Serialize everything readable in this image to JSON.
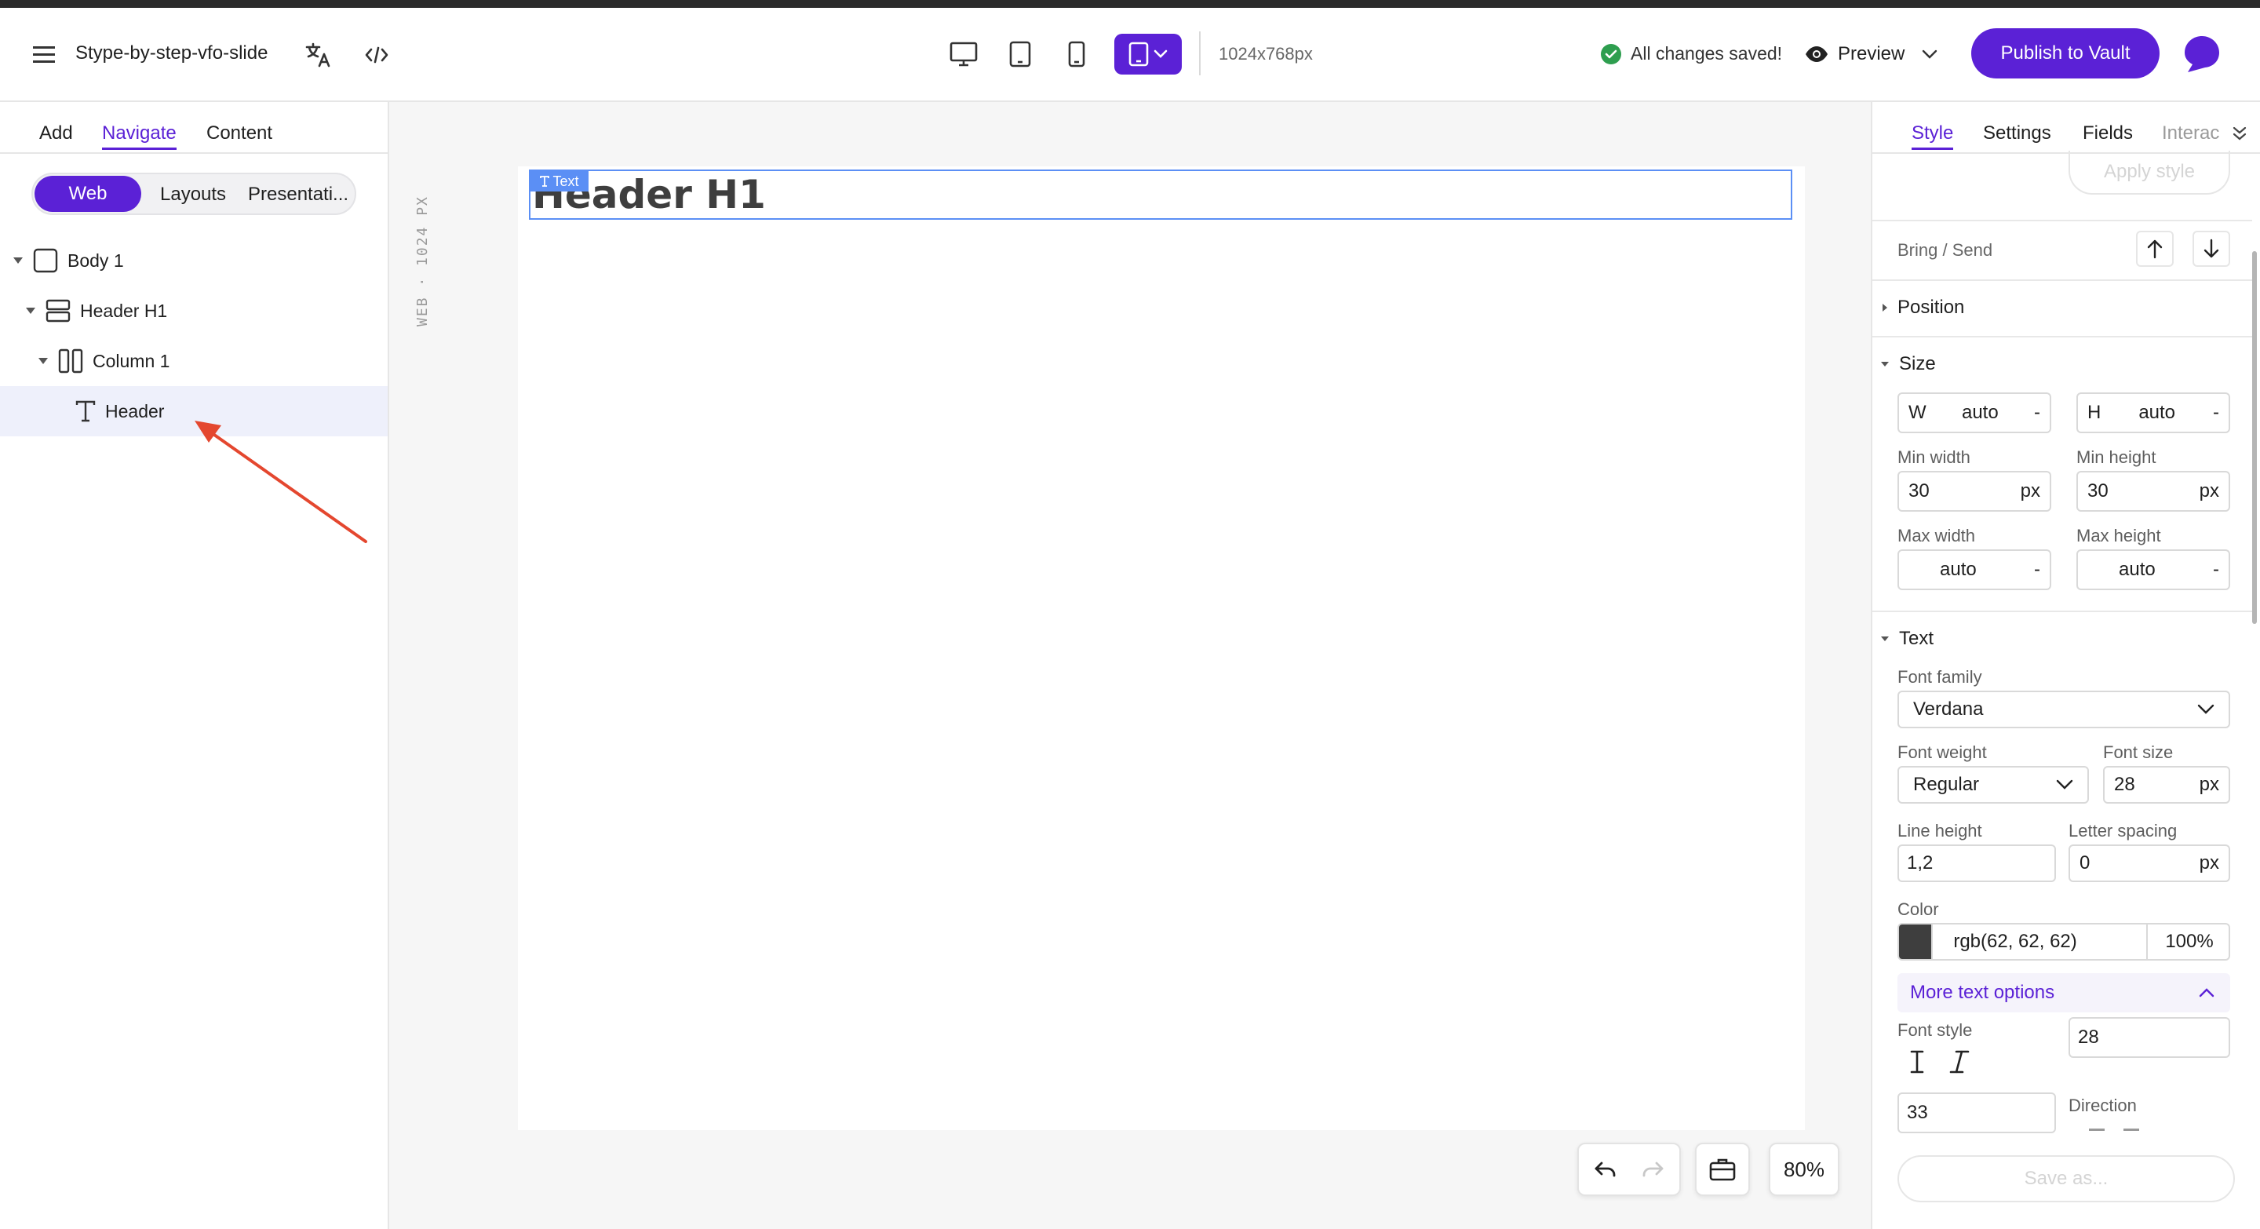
{
  "topbar": {
    "doc_title": "Stype-by-step-vfo-slide",
    "resolution": "1024x768px",
    "save_status": "All changes saved!",
    "preview_label": "Preview",
    "publish_label": "Publish to Vault"
  },
  "left_panel": {
    "tabs": [
      {
        "label": "Add"
      },
      {
        "label": "Navigate"
      },
      {
        "label": "Content"
      }
    ],
    "segments": [
      {
        "label": "Web"
      },
      {
        "label": "Layouts"
      },
      {
        "label": "Presentati..."
      }
    ],
    "tree": [
      {
        "label": "Body 1"
      },
      {
        "label": "Header H1"
      },
      {
        "label": "Column 1"
      },
      {
        "label": "Header"
      }
    ]
  },
  "canvas": {
    "vertical_label": "WEB · 1024 PX",
    "selection_tag": "Text",
    "heading_text": "Header H1",
    "zoom": "80%"
  },
  "right_panel": {
    "tabs": [
      {
        "label": "Style"
      },
      {
        "label": "Settings"
      },
      {
        "label": "Fields"
      },
      {
        "label": "Interac"
      }
    ],
    "apply_style": "Apply style",
    "bring_send": "Bring / Send",
    "position_title": "Position",
    "size_title": "Size",
    "w_label": "W",
    "w_value": "auto",
    "h_label": "H",
    "h_value": "auto",
    "dash": "-",
    "min_width_label": "Min width",
    "min_width_value": "30",
    "min_height_label": "Min height",
    "min_height_value": "30",
    "px": "px",
    "max_width_label": "Max width",
    "max_width_value": "auto",
    "max_height_label": "Max height",
    "max_height_value": "auto",
    "text_title": "Text",
    "font_family_label": "Font family",
    "font_family_value": "Verdana",
    "font_weight_label": "Font weight",
    "font_weight_value": "Regular",
    "font_size_label": "Font size",
    "font_size_value": "28",
    "line_height_label": "Line height",
    "line_height_value": "1,2",
    "letter_spacing_label": "Letter spacing",
    "letter_spacing_value": "0",
    "color_label": "Color",
    "color_value": "rgb(62, 62, 62)",
    "color_swatch": "#3e3e3e",
    "opacity_value": "100%",
    "more_text_options": "More text options",
    "font_style_label": "Font style",
    "font_style_value": "28",
    "direction_label": "Direction",
    "extra_value": "33",
    "save_as": "Save as..."
  },
  "colors": {
    "accent": "#5b21d6",
    "selection": "#5b8ff5",
    "arrow": "#e4472f",
    "saved_check": "#2e9e4f"
  }
}
